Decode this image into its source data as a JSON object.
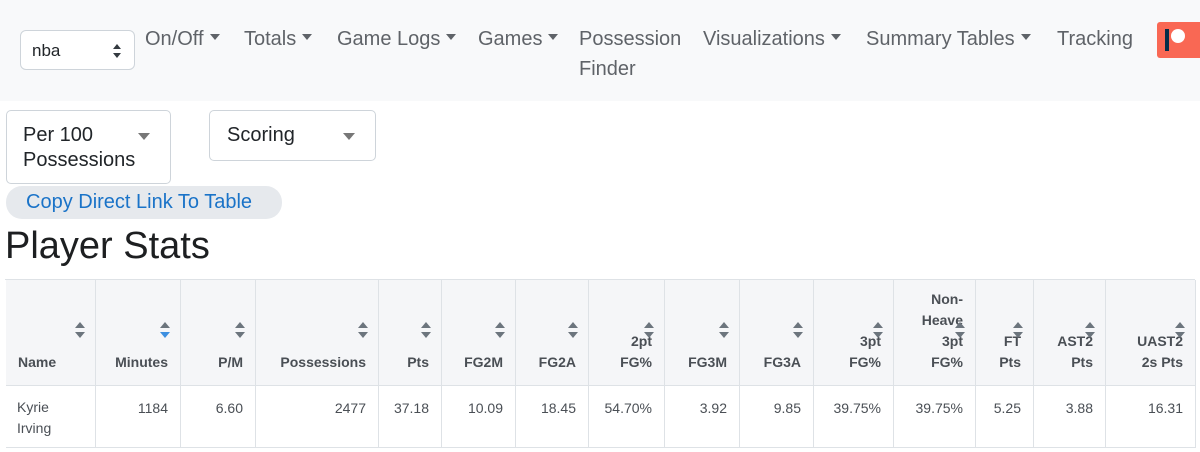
{
  "navbar": {
    "league_value": "nba",
    "items": [
      {
        "label": "On/Off",
        "dropdown": true
      },
      {
        "label": "Totals",
        "dropdown": true
      },
      {
        "label": "Game Logs",
        "dropdown": true
      },
      {
        "label": "Games",
        "dropdown": true
      },
      {
        "label": "Possession Finder",
        "dropdown": false
      },
      {
        "label": "Visualizations",
        "dropdown": true
      },
      {
        "label": "Summary Tables",
        "dropdown": true
      },
      {
        "label": "Tracking",
        "dropdown": false
      }
    ],
    "patreon_icon": "patreon-logo-icon",
    "patreon_color": "#f96854"
  },
  "filters": {
    "mode_value": "Per 100 Possessions",
    "stat_type_value": "Scoring"
  },
  "copy_link_label": "Copy Direct Link To Table",
  "title": "Player Stats",
  "table": {
    "columns": [
      "Name",
      "Minutes",
      "P/M",
      "Possessions",
      "Pts",
      "FG2M",
      "FG2A",
      "2pt\nFG%",
      "FG3M",
      "FG3A",
      "3pt\nFG%",
      "Non-\nHeave\n3pt\nFG%",
      "FT\nPts",
      "AST2\nPts",
      "UAST2\n2s Pts"
    ],
    "sorted_column": "Minutes",
    "sort_active_color": "#3d8fe0",
    "rows": [
      [
        "Kyrie\nIrving",
        "1184",
        "6.60",
        "2477",
        "37.18",
        "10.09",
        "18.45",
        "54.70%",
        "3.92",
        "9.85",
        "39.75%",
        "39.75%",
        "5.25",
        "3.88",
        "16.31"
      ]
    ]
  }
}
